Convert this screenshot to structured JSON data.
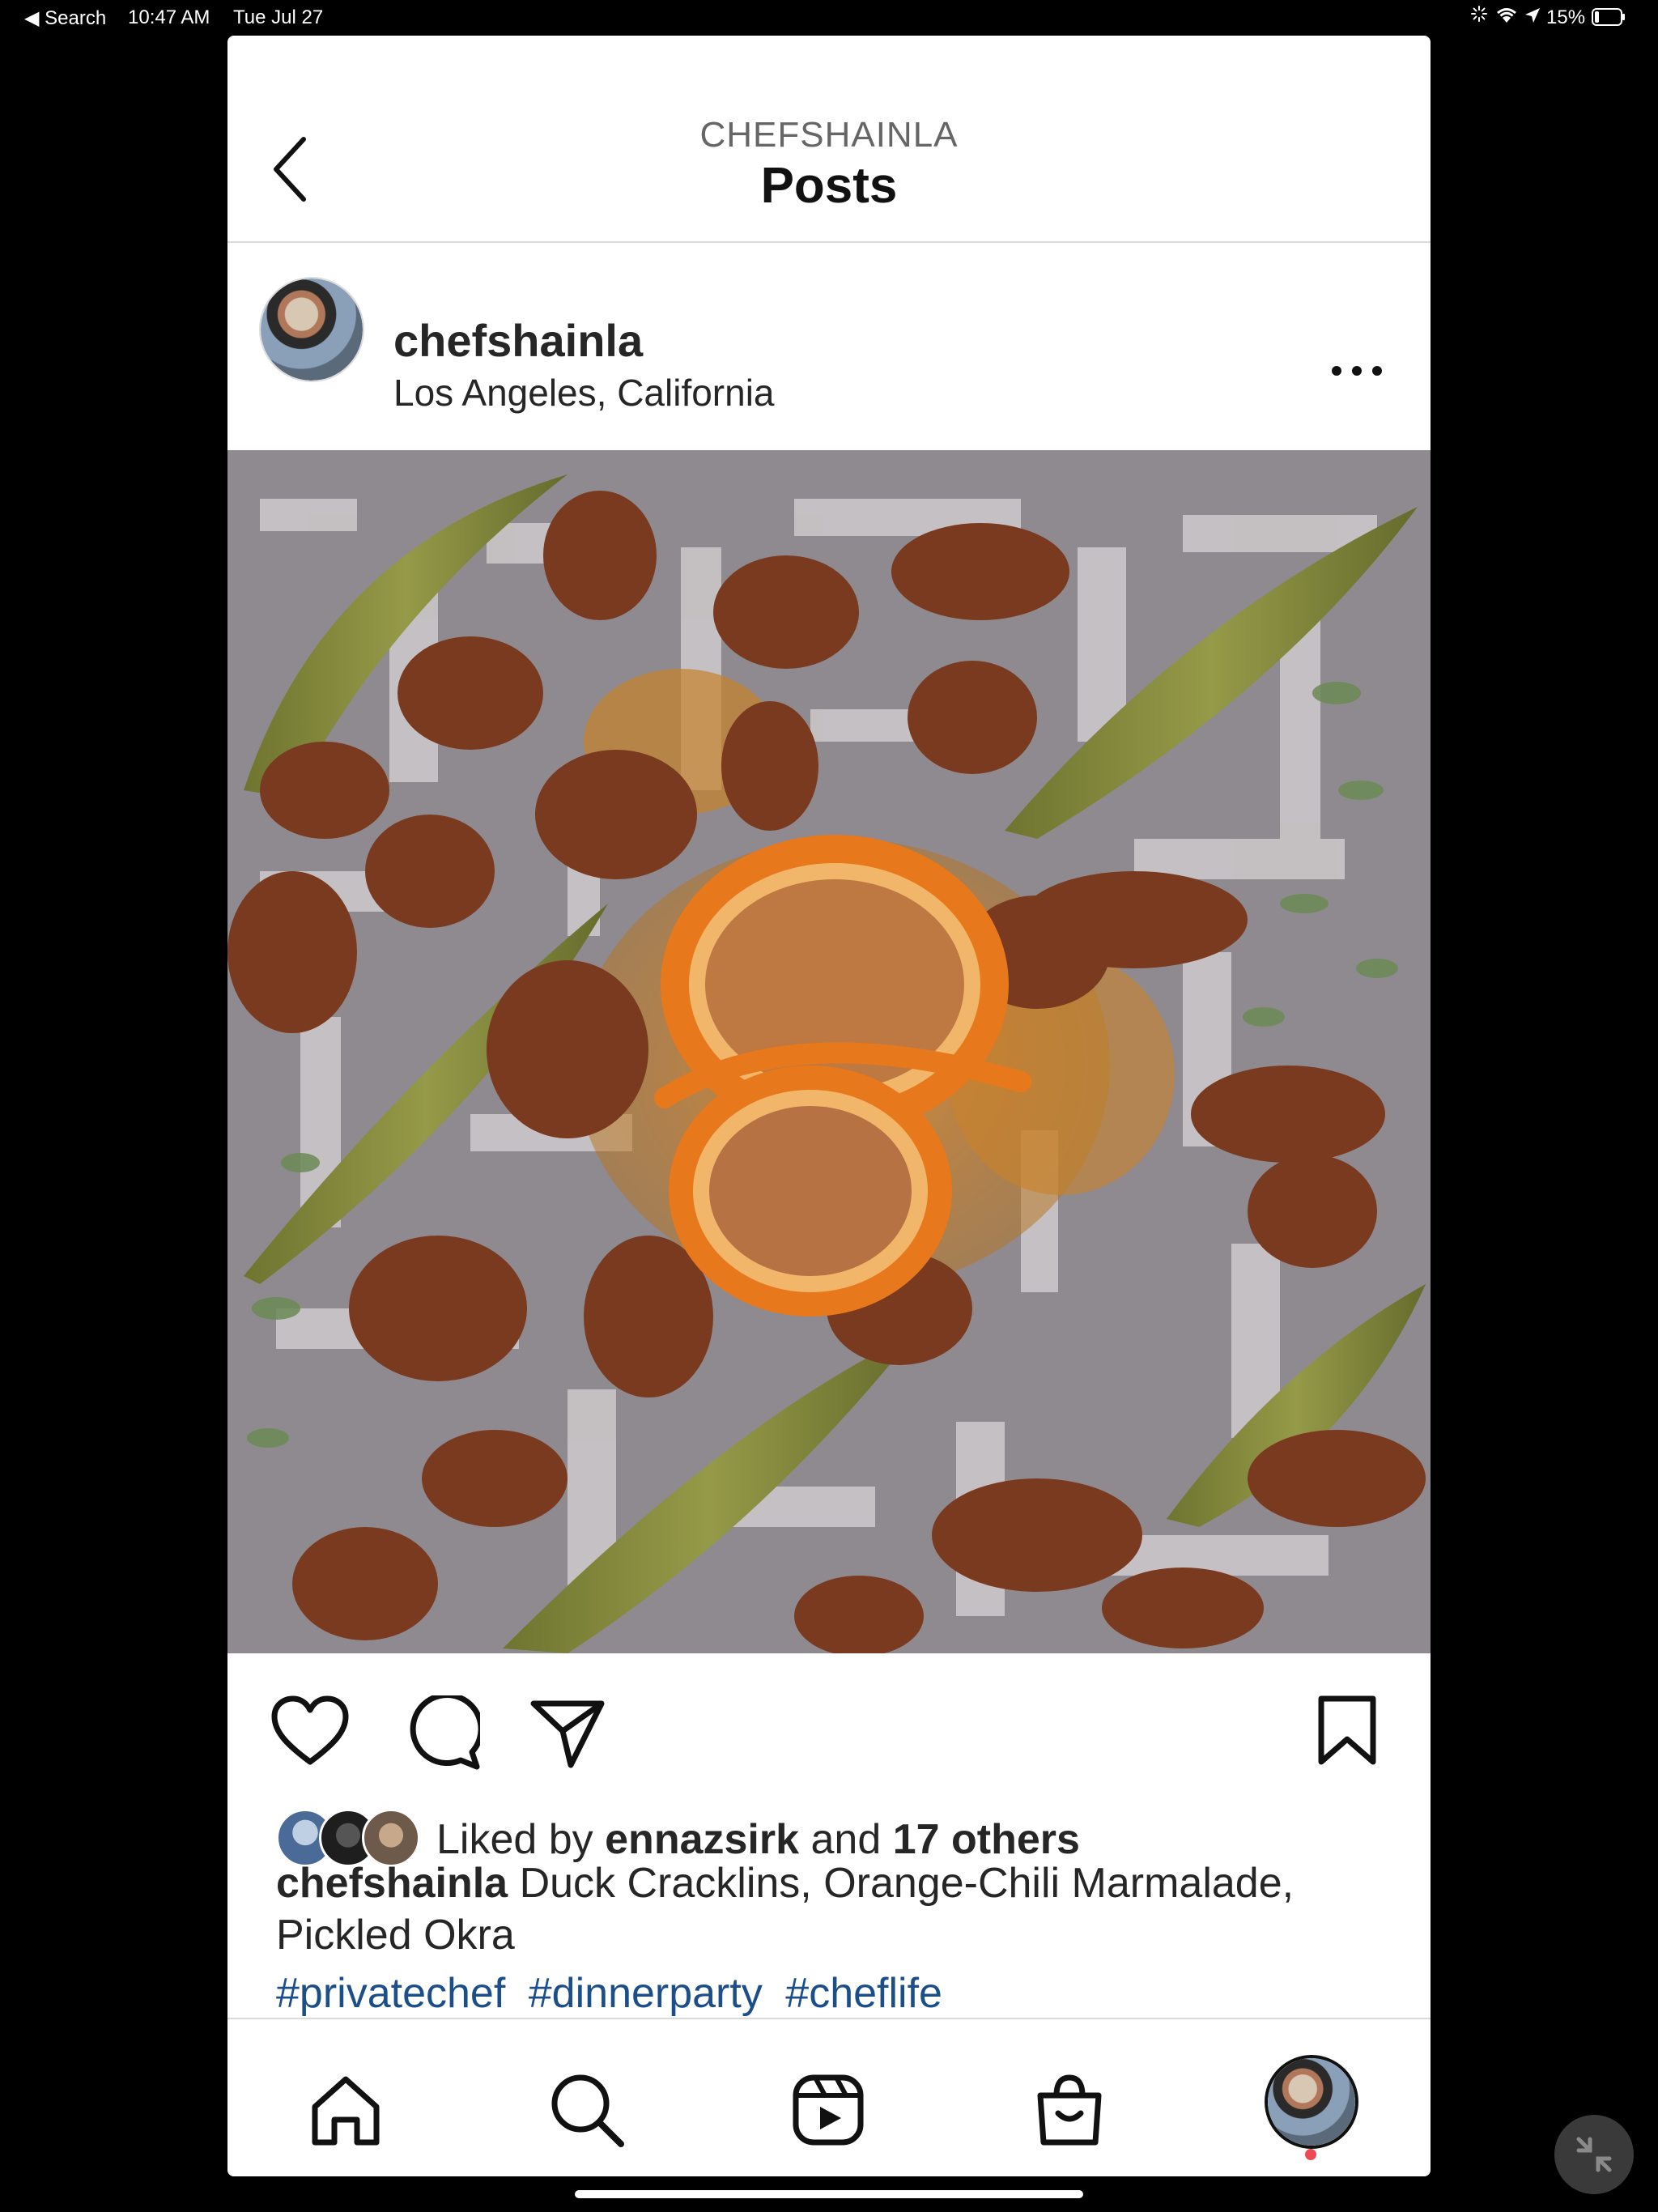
{
  "status_bar": {
    "back_app": "◀ Search",
    "time": "10:47 AM",
    "date": "Tue Jul 27",
    "battery": "15%"
  },
  "nav": {
    "subtitle": "CHEFSHAINLA",
    "title": "Posts"
  },
  "post": {
    "username": "chefshainla",
    "location": "Los Angeles, California",
    "likes": {
      "prefix": "Liked by",
      "user": "ennazsirk",
      "and": "and",
      "others": "17 others"
    },
    "caption": {
      "username": "chefshainla",
      "text": "Duck Cracklins, Orange-Chili Marmalade, Pickled Okra",
      "hashtags": [
        "#privatechef",
        "#dinnerparty",
        "#cheflife"
      ]
    }
  },
  "icons": {
    "back": "chevron-left-icon",
    "more": "more-horizontal-icon",
    "like": "heart-icon",
    "comment": "comment-icon",
    "share": "send-icon",
    "save": "bookmark-icon",
    "tabs": [
      "home-icon",
      "search-icon",
      "reels-icon",
      "shop-icon",
      "profile-avatar"
    ]
  },
  "colors": {
    "hashtag": "#1c4f8a",
    "notification_dot": "#ed4956"
  }
}
